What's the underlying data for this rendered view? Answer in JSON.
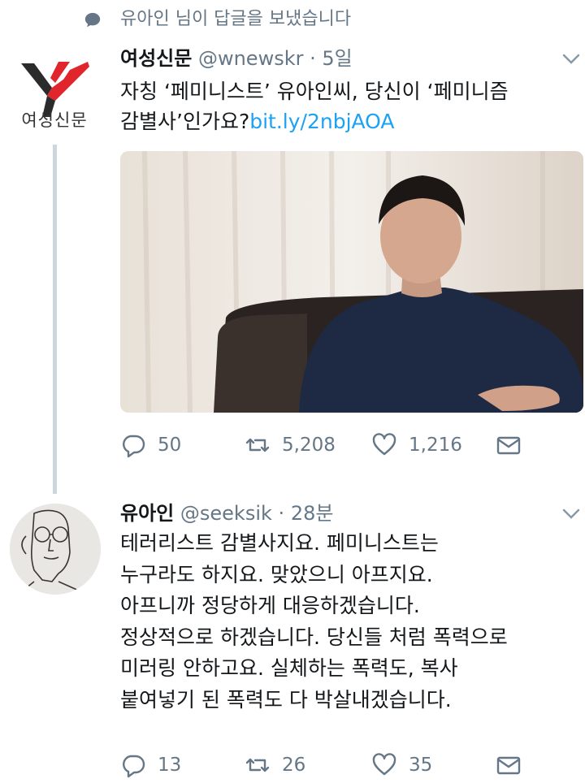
{
  "context": {
    "text": "유아인 님이 답글을 보냈습니다"
  },
  "tweets": [
    {
      "name": "여성신문",
      "handle": "@wnewskr",
      "separator": "·",
      "time": "5일",
      "avatar_text": "여성신문",
      "text_line1": "자칭 ‘페미니스트’ 유아인씨, 당신이 ‘페미니즘",
      "text_line2": "감별사’인가요?",
      "link": "bit.ly/2nbjAOA",
      "has_photo": true,
      "replies": "50",
      "retweets": "5,208",
      "likes": "1,216"
    },
    {
      "name": "유아인",
      "handle": "@seeksik",
      "separator": "·",
      "time": "28분",
      "lines": [
        "테러리스트 감별사지요. 페미니스트는",
        "누구라도 하지요. 맞았으니 아프지요.",
        "아프니까 정당하게 대응하겠습니다.",
        "정상적으로 하겠습니다. 당신들 처럼 폭력으로",
        "미러링 안하고요. 실체하는 폭력도, 복사",
        "붙여넣기 된 폭력도 다 박살내겠습니다."
      ],
      "replies": "13",
      "retweets": "26",
      "likes": "35"
    }
  ],
  "colors": {
    "text": "#14171a",
    "secondary": "#657786",
    "link": "#1da1f2",
    "thread_line": "#ccd6dd",
    "logo_red": "#e0262c",
    "logo_dark": "#2b2b2b"
  },
  "icons": [
    "speech-bubble-icon",
    "chevron-down-icon",
    "reply-icon",
    "retweet-icon",
    "like-icon",
    "direct-message-icon"
  ]
}
